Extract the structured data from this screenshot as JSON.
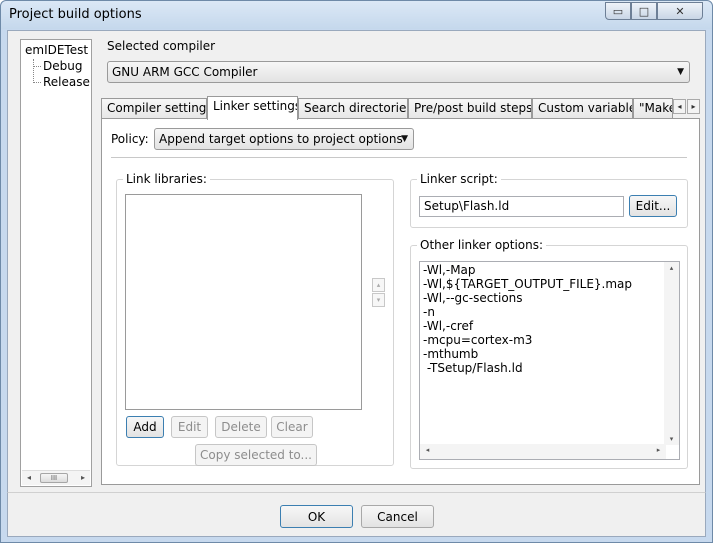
{
  "window": {
    "title": "Project build options"
  },
  "window_controls": {
    "minimize": "▭",
    "maximize": "□",
    "close": "✕"
  },
  "tree": {
    "root": "emIDETest",
    "children": [
      "Debug",
      "Release"
    ],
    "hscroll": {
      "left": "◂",
      "thumb": "III",
      "right": "▸"
    }
  },
  "compiler": {
    "label": "Selected compiler",
    "value": "GNU ARM GCC Compiler",
    "arrow": "▼"
  },
  "tabs": {
    "items": [
      "Compiler settings",
      "Linker settings",
      "Search directories",
      "Pre/post build steps",
      "Custom variables",
      "\"Make"
    ],
    "active_index": 1,
    "scroll_left": "◂",
    "scroll_right": "▸"
  },
  "policy": {
    "label": "Policy:",
    "value": "Append target options to project options",
    "arrow": "▼"
  },
  "link_libraries": {
    "title": "Link libraries:",
    "items": [],
    "spin_up": "▴",
    "spin_down": "▾",
    "buttons": {
      "add": "Add",
      "edit": "Edit",
      "delete": "Delete",
      "clear": "Clear",
      "copy": "Copy selected to..."
    }
  },
  "linker_script": {
    "title": "Linker script:",
    "value": "Setup\\Flash.ld",
    "edit_button": "Edit..."
  },
  "other_options": {
    "title": "Other linker options:",
    "lines": [
      "-Wl,-Map",
      "-Wl,${TARGET_OUTPUT_FILE}.map",
      "-Wl,--gc-sections",
      "-n",
      "-Wl,-cref",
      "-mcpu=cortex-m3",
      "-mthumb",
      " -TSetup/Flash.ld"
    ],
    "scroll_up": "▴",
    "scroll_down": "▾",
    "scroll_left": "◂",
    "scroll_right": "▸"
  },
  "dialog_buttons": {
    "ok": "OK",
    "cancel": "Cancel"
  }
}
